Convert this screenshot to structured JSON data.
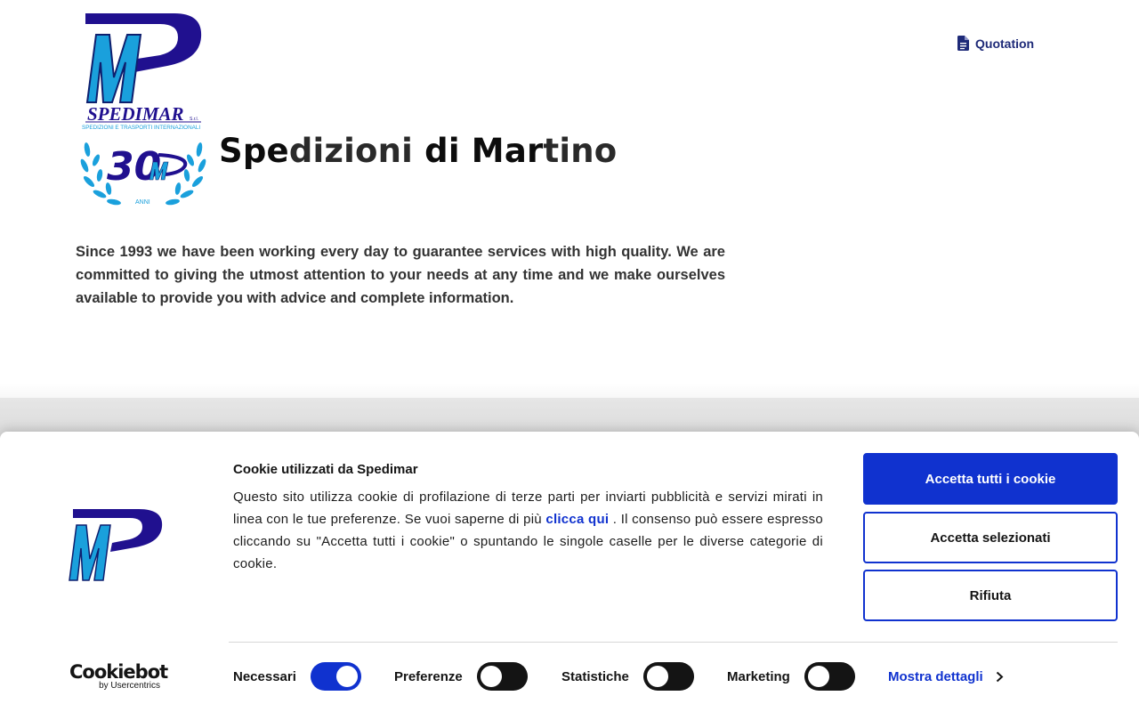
{
  "header": {
    "logo_text": "SPEDIMAR",
    "logo_suffix": "S.r.l.",
    "logo_tagline": "SPEDIZIONI E TRASPORTI INTERNAZIONALI",
    "anniversary_number": "30",
    "anniversary_label": "ANNI",
    "quotation_label": "Quotation",
    "quotation_icon": "document-icon"
  },
  "hero": {
    "title_part1": "Spe",
    "title_part2": "dizioni",
    "title_part3": " di ",
    "title_part4": "Mar",
    "title_part5": "tino",
    "intro": "Since 1993 we have been working every day to guarantee services with high quality. We are committed to giving the utmost attention to your needs at any time and we make ourselves available to provide you with advice and complete information."
  },
  "cookie_banner": {
    "title": "Cookie utilizzati da Spedimar",
    "text_before_link": "Questo sito utilizza cookie di profilazione di terze parti per inviarti pubblicità e servizi mirati in linea con le tue preferenze. Se vuoi saperne di più ",
    "link_label": "clicca qui",
    "text_after_link": " . Il consenso può essere espresso cliccando su \"Accetta tutti i cookie\" o spuntando le singole caselle per le diverse categorie di cookie.",
    "accept_all_label": "Accetta tutti i cookie",
    "accept_selected_label": "Accetta selezionati",
    "reject_label": "Rifiuta",
    "brand_word": "Cookiebot",
    "brand_by": "by Usercentrics",
    "toggles": [
      {
        "label": "Necessari",
        "on": true
      },
      {
        "label": "Preferenze",
        "on": false
      },
      {
        "label": "Statistiche",
        "on": false
      },
      {
        "label": "Marketing",
        "on": false
      }
    ],
    "details_label": "Mostra dettagli",
    "details_icon": "chevron-right-icon"
  },
  "colors": {
    "brand_navy": "#20108f",
    "brand_cyan": "#1aa0dc",
    "accent_blue": "#1032cf"
  }
}
